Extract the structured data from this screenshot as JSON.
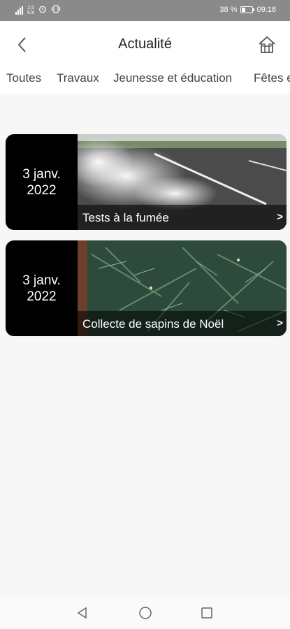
{
  "status_bar": {
    "network": "4G",
    "speed_value": "2,5",
    "speed_unit": "K/s",
    "battery": "38 %",
    "battery_level": 0.38,
    "time": "09:18"
  },
  "header": {
    "title": "Actualité",
    "back_icon": "chevron-left-icon",
    "home_icon": "home-icon"
  },
  "tabs": [
    "Toutes",
    "Travaux",
    "Jeunesse et éducation",
    "Fêtes e"
  ],
  "news": [
    {
      "date_line1": "3 janv.",
      "date_line2": "2022",
      "title": "Tests à la fumée",
      "arrow": ">"
    },
    {
      "date_line1": "3 janv.",
      "date_line2": "2022",
      "title": "Collecte de sapins de Noël",
      "arrow": ">"
    }
  ],
  "navbar": [
    "back-triangle-icon",
    "home-circle-icon",
    "recents-square-icon"
  ],
  "colors": {
    "status_bg": "#8a8a8a",
    "card_bg": "#000000",
    "page_bg": "#f7f7f7"
  }
}
